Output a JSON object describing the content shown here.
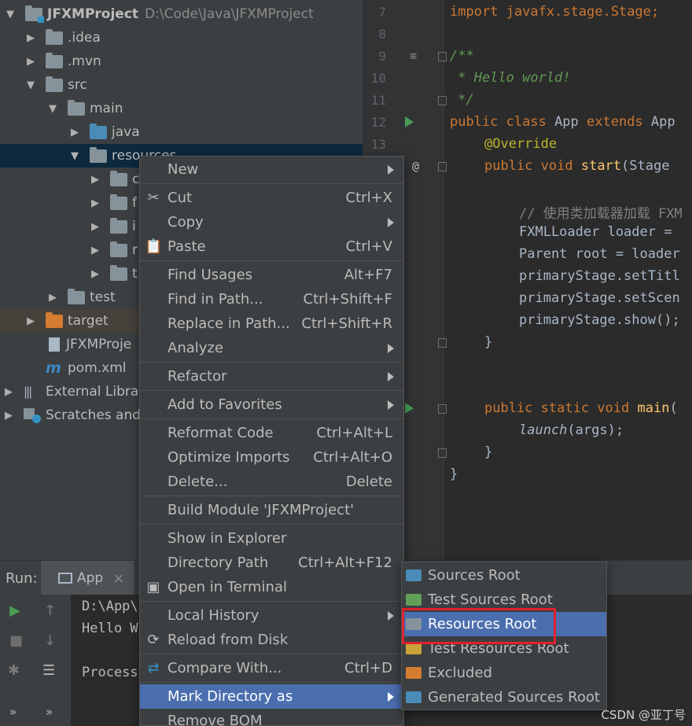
{
  "tree": {
    "project_name": "JFXMProject",
    "project_path": "D:\\Code\\Java\\JFXMProject",
    "items": [
      {
        "arrow": "▼",
        "icon": "project-folder-icon",
        "label": "JFXMProject",
        "indent": 0
      },
      {
        "arrow": "▶",
        "icon": "folder-icon",
        "label": ".idea"
      },
      {
        "arrow": "▶",
        "icon": "folder-icon",
        "label": ".mvn"
      },
      {
        "arrow": "▼",
        "icon": "folder-icon",
        "label": "src"
      },
      {
        "arrow": "▼",
        "icon": "folder-icon",
        "label": "main"
      },
      {
        "arrow": "▶",
        "icon": "source-folder-icon",
        "label": "java"
      },
      {
        "arrow": "▼",
        "icon": "folder-icon",
        "label": "resources"
      },
      {
        "arrow": "▶",
        "icon": "folder-icon",
        "label": "c"
      },
      {
        "arrow": "▶",
        "icon": "folder-icon",
        "label": "f"
      },
      {
        "arrow": "▶",
        "icon": "folder-icon",
        "label": "i"
      },
      {
        "arrow": "▶",
        "icon": "folder-icon",
        "label": "r"
      },
      {
        "arrow": "▶",
        "icon": "folder-icon",
        "label": "t"
      },
      {
        "arrow": "▶",
        "icon": "folder-icon",
        "label": "test"
      },
      {
        "arrow": "▶",
        "icon": "excluded-folder-icon",
        "label": "target"
      },
      {
        "arrow": "",
        "icon": "iml-file-icon",
        "label": "JFXMProje"
      },
      {
        "arrow": "",
        "icon": "maven-icon",
        "label": "pom.xml"
      },
      {
        "arrow": "▶",
        "icon": "library-icon",
        "label": "External Libra"
      },
      {
        "arrow": "▶",
        "icon": "scratches-icon",
        "label": "Scratches and"
      }
    ]
  },
  "editor": {
    "line_numbers": [
      "7",
      "8",
      "9",
      "10",
      "11",
      "12",
      "13"
    ],
    "lines": {
      "l1": "import javafx.stage.Stage;",
      "l3": "/**",
      "l4": " * Hello world!",
      "l5": " */",
      "l6_kw": "public class",
      "l6_name": " App ",
      "l6_kw2": "extends",
      "l6_rest": " App",
      "l7": "@Override",
      "l8_kw": "public void",
      "l8_fn": "start",
      "l8_rest": "(Stage ",
      "l10": "// 使用类加载器加载 FXM",
      "l11": "FXMLLoader loader = ",
      "l12": "Parent root = loader",
      "l13": "primaryStage.setTitl",
      "l14": "primaryStage.setScen",
      "l15": "primaryStage.show();",
      "l16": "}",
      "l19_kw": "public static void",
      "l19_fn": "main",
      "l19_rest": "(",
      "l20_fn": "launch",
      "l20_rest": "(args);",
      "l21": "}",
      "l22": "}"
    }
  },
  "run": {
    "label": "Run:",
    "tab": "App",
    "close": "×",
    "console": [
      "D:\\App\\",
      "Hello W",
      "Process"
    ]
  },
  "menu": {
    "items": [
      {
        "label": "New",
        "key": "",
        "submenu": true
      },
      {
        "label": "Cut",
        "key": "Ctrl+X",
        "icon": "scissors-icon"
      },
      {
        "label": "Copy",
        "key": "",
        "submenu": true
      },
      {
        "label": "Paste",
        "key": "Ctrl+V",
        "icon": "clipboard-icon"
      },
      {
        "label": "Find Usages",
        "key": "Alt+F7"
      },
      {
        "label": "Find in Path...",
        "key": "Ctrl+Shift+F"
      },
      {
        "label": "Replace in Path...",
        "key": "Ctrl+Shift+R"
      },
      {
        "label": "Analyze",
        "key": "",
        "submenu": true
      },
      {
        "label": "Refactor",
        "key": "",
        "submenu": true
      },
      {
        "label": "Add to Favorites",
        "key": "",
        "submenu": true
      },
      {
        "label": "Reformat Code",
        "key": "Ctrl+Alt+L"
      },
      {
        "label": "Optimize Imports",
        "key": "Ctrl+Alt+O"
      },
      {
        "label": "Delete...",
        "key": "Delete"
      },
      {
        "label": "Build Module 'JFXMProject'",
        "key": ""
      },
      {
        "label": "Show in Explorer",
        "key": ""
      },
      {
        "label": "Directory Path",
        "key": "Ctrl+Alt+F12"
      },
      {
        "label": "Open in Terminal",
        "key": "",
        "icon": "terminal-icon"
      },
      {
        "label": "Local History",
        "key": "",
        "submenu": true
      },
      {
        "label": "Reload from Disk",
        "key": "",
        "icon": "reload-icon"
      },
      {
        "label": "Compare With...",
        "key": "Ctrl+D",
        "icon": "compare-icon"
      },
      {
        "label": "Mark Directory as",
        "key": "",
        "submenu": true,
        "active": true
      },
      {
        "label": "Remove BOM",
        "key": ""
      }
    ]
  },
  "submenu": {
    "items": [
      {
        "label": "Sources Root",
        "color": "#4a8bb8"
      },
      {
        "label": "Test Sources Root",
        "color": "#62a05a"
      },
      {
        "label": "Resources Root",
        "color": "#87939a",
        "active": true
      },
      {
        "label": "Test Resources Root",
        "color": "#c9a33a"
      },
      {
        "label": "Excluded",
        "color": "#d57b32"
      },
      {
        "label": "Generated Sources Root",
        "color": "#4a8bb8"
      }
    ]
  },
  "watermark": "CSDN @亚丁号",
  "colors": {
    "menu_active": "#4b6eaf",
    "highlight_box": "#e0212f",
    "selection": "#0d293e"
  }
}
